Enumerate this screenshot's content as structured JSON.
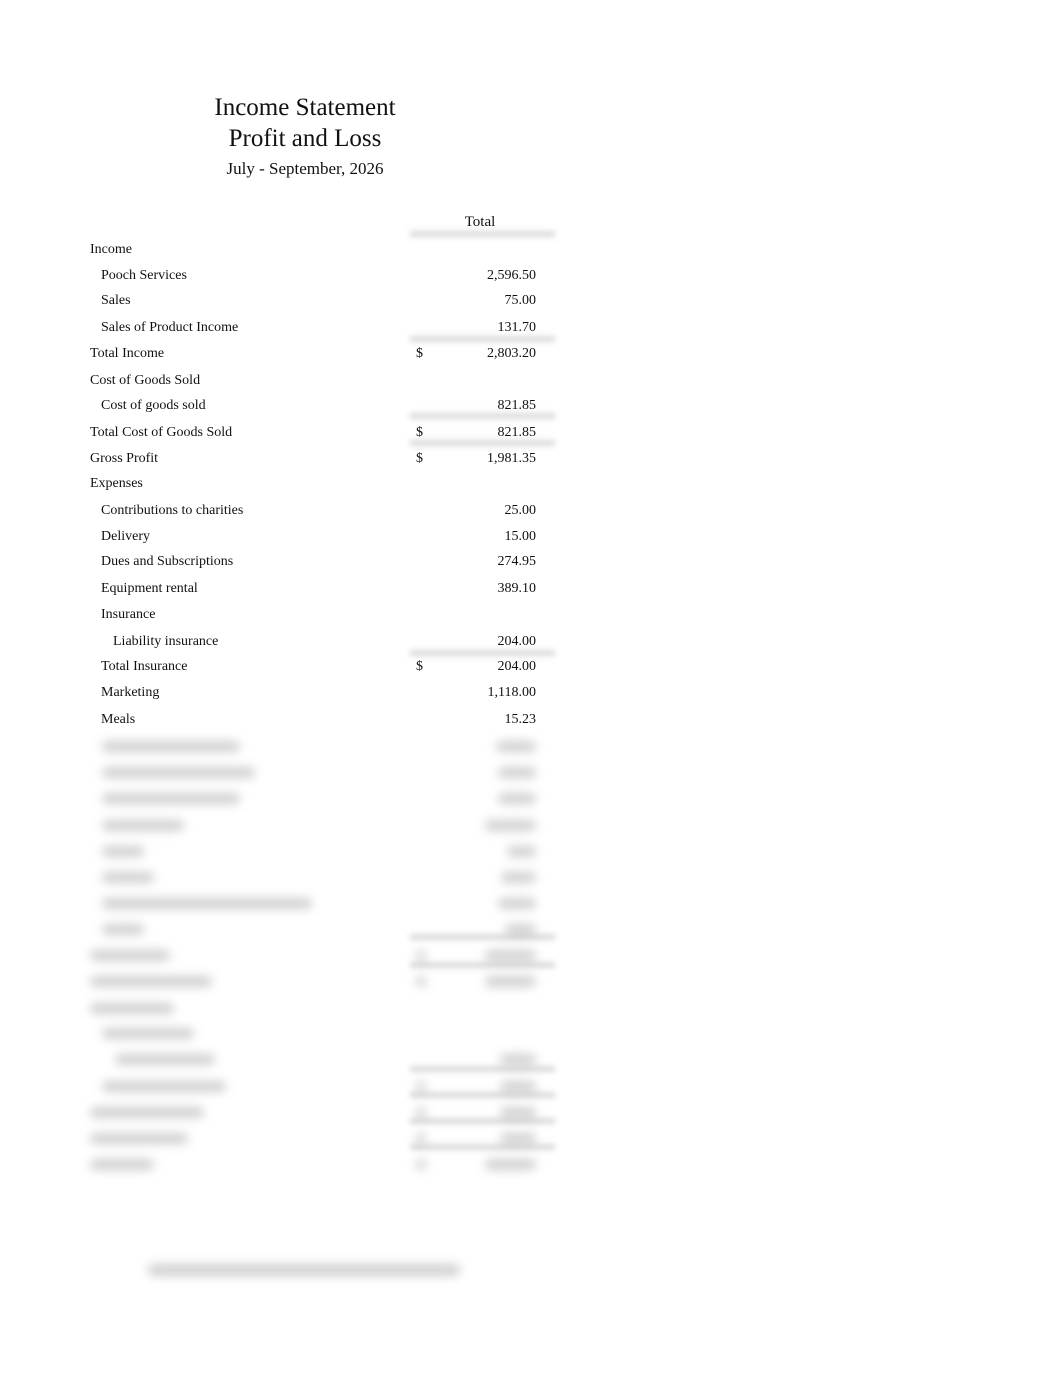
{
  "header": {
    "title": "Income Statement",
    "subtitle": "Profit and Loss",
    "period": "July - September, 2026"
  },
  "table": {
    "column_header": "Total",
    "rows": [
      {
        "label": "Income",
        "level": 0,
        "dollar": "",
        "amount": ""
      },
      {
        "label": "Pooch Services",
        "level": 1,
        "dollar": "",
        "amount": "2,596.50"
      },
      {
        "label": "Sales",
        "level": 1,
        "dollar": "",
        "amount": "75.00"
      },
      {
        "label": "Sales of Product Income",
        "level": 1,
        "dollar": "",
        "amount": "131.70"
      },
      {
        "label": "Total Income",
        "level": 0,
        "dollar": "$",
        "amount": "2,803.20"
      },
      {
        "label": "Cost of Goods Sold",
        "level": 0,
        "dollar": "",
        "amount": ""
      },
      {
        "label": "Cost of goods sold",
        "level": 1,
        "dollar": "",
        "amount": "821.85"
      },
      {
        "label": "Total Cost of Goods Sold",
        "level": 0,
        "dollar": "$",
        "amount": "821.85"
      },
      {
        "label": "Gross Profit",
        "level": 0,
        "dollar": "$",
        "amount": "1,981.35"
      },
      {
        "label": "Expenses",
        "level": 0,
        "dollar": "",
        "amount": ""
      },
      {
        "label": "Contributions to charities",
        "level": 1,
        "dollar": "",
        "amount": "25.00"
      },
      {
        "label": "Delivery",
        "level": 1,
        "dollar": "",
        "amount": "15.00"
      },
      {
        "label": "Dues and Subscriptions",
        "level": 1,
        "dollar": "",
        "amount": "274.95"
      },
      {
        "label": "Equipment rental",
        "level": 1,
        "dollar": "",
        "amount": "389.10"
      },
      {
        "label": "Insurance",
        "level": 1,
        "dollar": "",
        "amount": ""
      },
      {
        "label": "Liability insurance",
        "level": 2,
        "dollar": "",
        "amount": "204.00"
      },
      {
        "label": "Total Insurance",
        "level": 1,
        "dollar": "$",
        "amount": "204.00"
      },
      {
        "label": "Marketing",
        "level": 1,
        "dollar": "",
        "amount": "1,118.00"
      },
      {
        "label": "Meals",
        "level": 1,
        "dollar": "",
        "amount": "15.23"
      }
    ]
  }
}
